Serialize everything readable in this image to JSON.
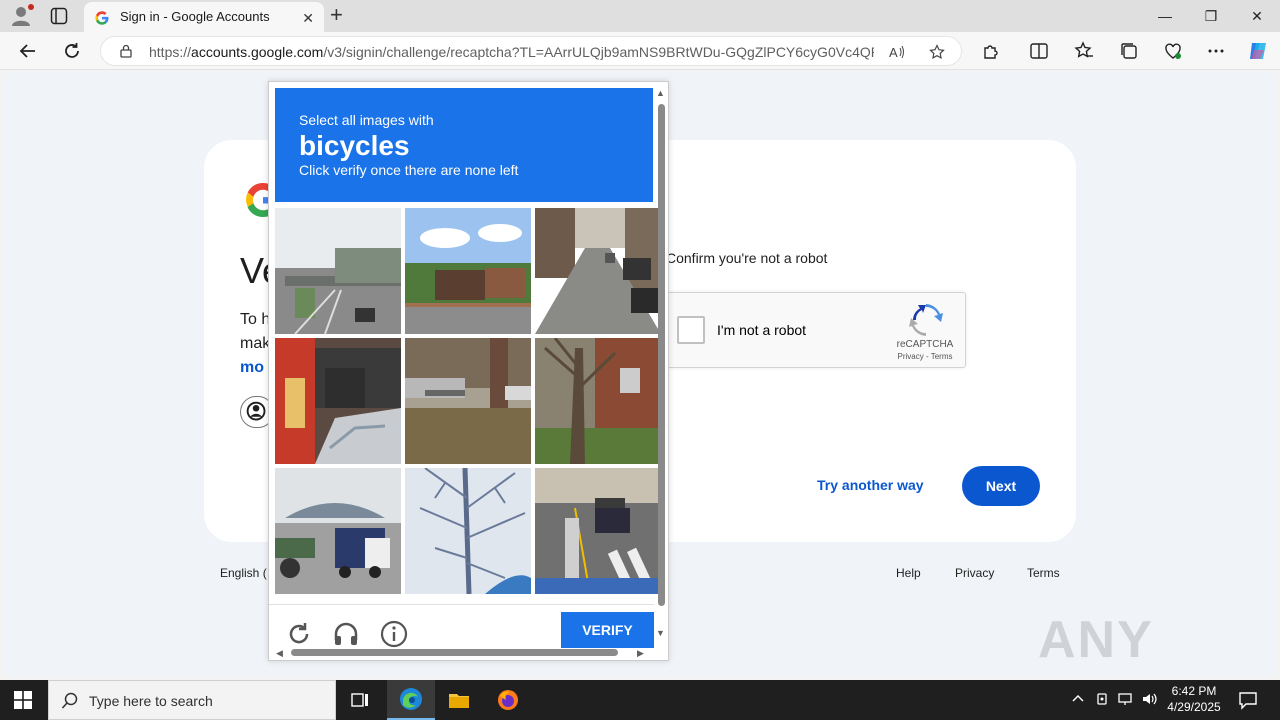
{
  "browser": {
    "tab_title": "Sign in - Google Accounts",
    "url_prefix": "https://",
    "url_domain": "accounts.google.com",
    "url_path": "/v3/signin/challenge/recaptcha?TL=AArrULQjb9amNS9BRtWDu-GQgZlPCY6cyG0Vc4QR...",
    "new_tab": "+",
    "minimize": "—",
    "maximize": "❐",
    "close": "✕",
    "tab_close": "✕"
  },
  "signin": {
    "heading_partial": "Ve",
    "desc_line1_partial": "To h",
    "desc_line2_partial": "mak",
    "more_partial": "mo",
    "confirm_text": "Confirm you're not a robot",
    "checkbox_label": "I'm not a robot",
    "recaptcha_brand": "reCAPTCHA",
    "recaptcha_terms": "Privacy - Terms",
    "try_another": "Try another way",
    "next": "Next"
  },
  "footer": {
    "language_partial": "English (",
    "help": "Help",
    "privacy": "Privacy",
    "terms": "Terms"
  },
  "challenge": {
    "line1": "Select all images with",
    "target": "bicycles",
    "line3": "Click verify once there are none left",
    "verify": "VERIFY",
    "tiles": [
      {
        "name": "highway-overpass"
      },
      {
        "name": "roadside-houses-trees"
      },
      {
        "name": "street-parked-cars"
      },
      {
        "name": "bus-side-crowd"
      },
      {
        "name": "tree-lined-street"
      },
      {
        "name": "tree-brick-house"
      },
      {
        "name": "truck-parking-lot"
      },
      {
        "name": "tree-shadow-snow"
      },
      {
        "name": "crosswalk-cars"
      }
    ],
    "colors": {
      "header": "#1a73e8",
      "button": "#1a73e8"
    }
  },
  "taskbar": {
    "search_placeholder": "Type here to search",
    "time": "6:42 PM",
    "date": "4/29/2025"
  },
  "watermark": "ANY RUN",
  "colors": {
    "google_blue": "#0b57d0",
    "page_bg": "#f0f4f9"
  }
}
